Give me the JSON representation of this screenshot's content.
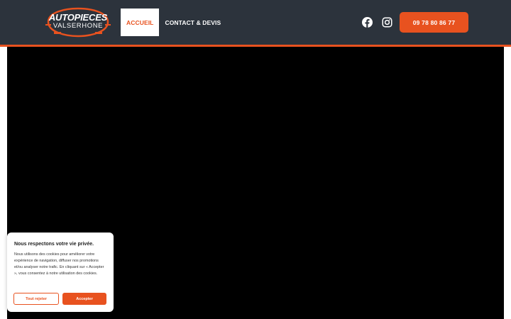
{
  "header": {
    "logo": {
      "line1": "AUTOPIECES",
      "line2": "VALSERHONE",
      "icon": "autopieces-logo-icon"
    },
    "nav": [
      {
        "label": "ACCUEIL",
        "active": true
      },
      {
        "label": "CONTACT & DEVIS",
        "active": false
      }
    ],
    "social": [
      {
        "icon": "facebook-icon"
      },
      {
        "icon": "instagram-icon"
      }
    ],
    "phone_label": "09 78 80 86 77"
  },
  "colors": {
    "header_bg": "#2c333c",
    "accent": "#e8521f",
    "video_bg": "#000000"
  },
  "cookie_banner": {
    "title": "Nous respectons votre vie privée.",
    "text": "Nous utilisons des cookies pour améliorer votre expérience de navigation, diffuser nos promotions et/ou analyser notre trafic. En cliquant sur « Accepter », vous consentez à notre utilisation des cookies.",
    "reject_label": "Tout rejeter",
    "accept_label": "Accepter"
  }
}
